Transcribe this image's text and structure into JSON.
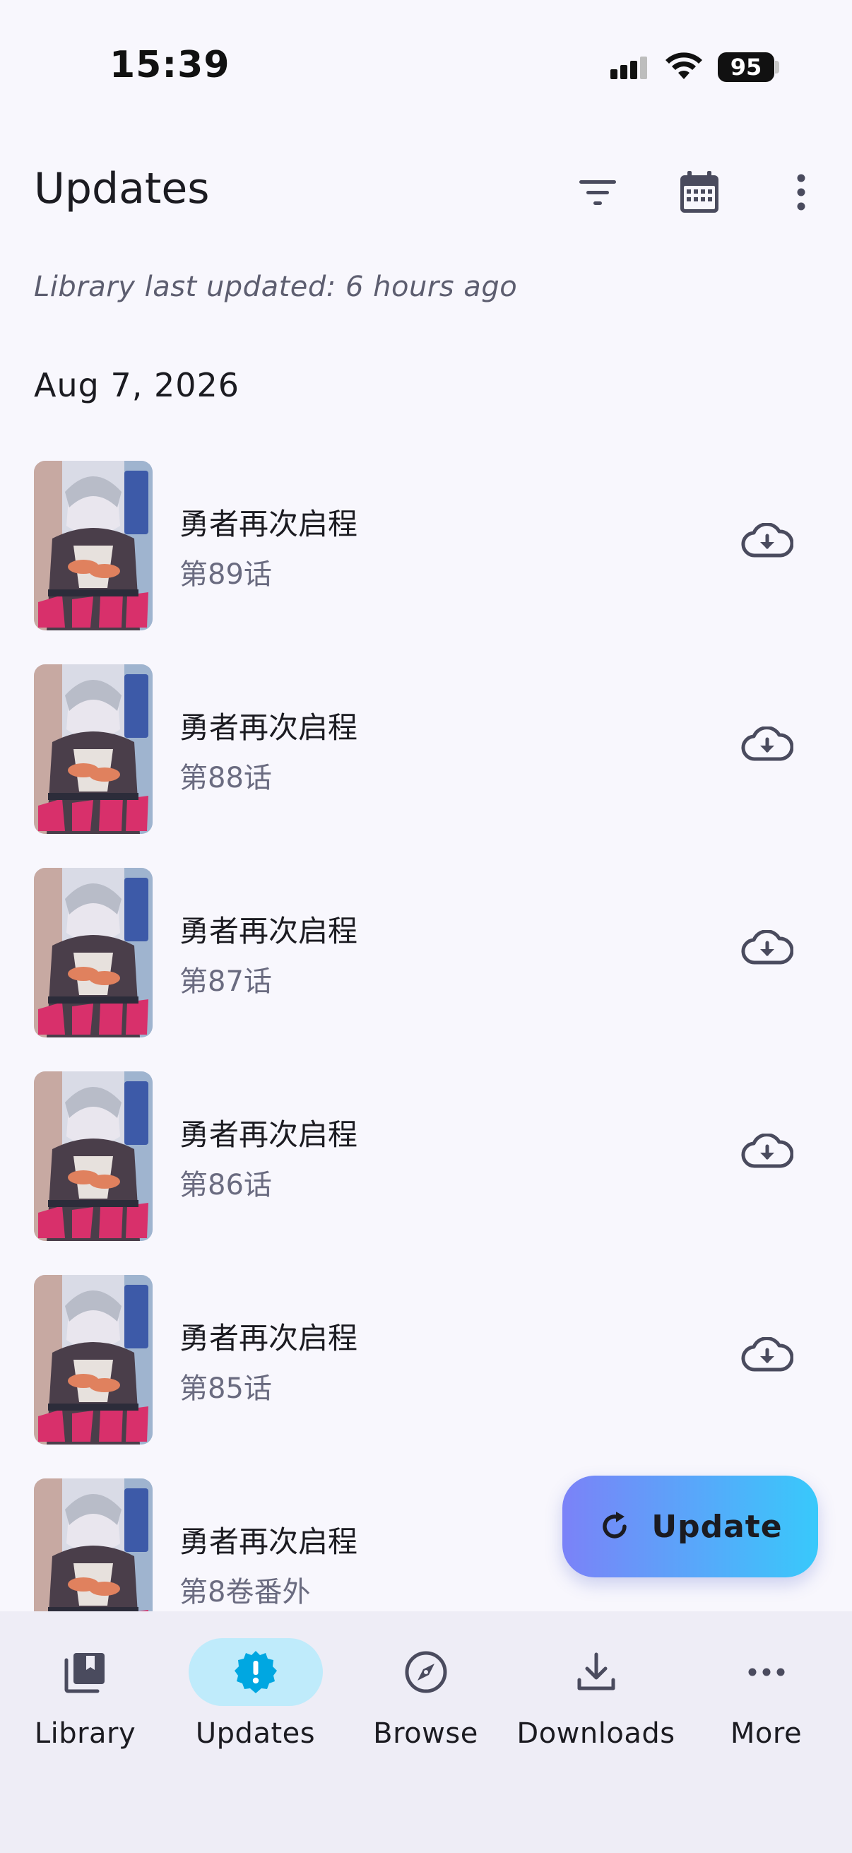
{
  "status_bar": {
    "time": "15:39",
    "battery": "95"
  },
  "header": {
    "title": "Updates",
    "icons": [
      "filter-icon",
      "calendar-icon",
      "more-vert-icon"
    ]
  },
  "last_updated": "Library last updated: 6 hours ago",
  "date_group": "Aug 7, 2026",
  "updates": [
    {
      "title": "勇者再次启程",
      "chapter": "第89话"
    },
    {
      "title": "勇者再次启程",
      "chapter": "第88话"
    },
    {
      "title": "勇者再次启程",
      "chapter": "第87话"
    },
    {
      "title": "勇者再次启程",
      "chapter": "第86话"
    },
    {
      "title": "勇者再次启程",
      "chapter": "第85话"
    },
    {
      "title": "勇者再次启程",
      "chapter": "第8卷番外"
    }
  ],
  "fab": {
    "label": "Update",
    "icon": "refresh-icon"
  },
  "nav": [
    {
      "label": "Library",
      "icon": "library-icon"
    },
    {
      "label": "Updates",
      "icon": "updates-icon",
      "active": true
    },
    {
      "label": "Browse",
      "icon": "compass-icon"
    },
    {
      "label": "Downloads",
      "icon": "download-icon"
    },
    {
      "label": "More",
      "icon": "more-horiz-icon"
    }
  ],
  "colors": {
    "accent_gradient_start": "#7b82f8",
    "accent_gradient_end": "#38c9fb",
    "nav_active": "#bfebfb",
    "background": "#f8f7fd"
  }
}
